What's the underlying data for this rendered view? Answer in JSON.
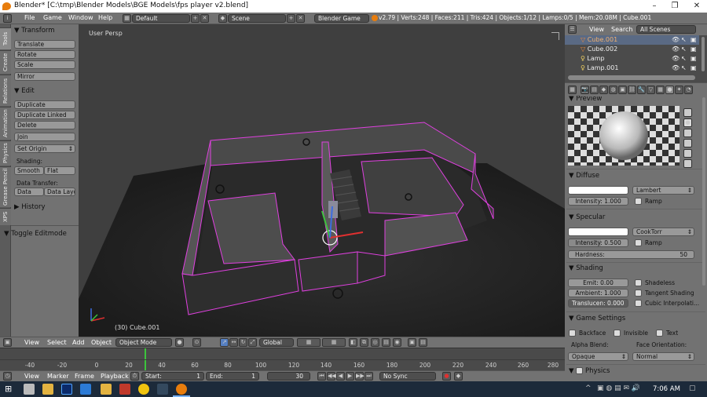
{
  "window": {
    "title": "Blender* [C:\\tmp\\Blender Models\\BGE Models\\fps player v2.blend]",
    "minimize": "–",
    "maximize": "❐",
    "close": "✕"
  },
  "infobar": {
    "menus": [
      "File",
      "Game",
      "Window",
      "Help"
    ],
    "layout": "Default",
    "scene": "Scene",
    "engine": "Blender Game",
    "stats": "v2.79 | Verts:248 | Faces:211 | Tris:424 | Objects:1/12 | Lamps:0/5 | Mem:20.08M | Cube.001"
  },
  "toolshelf": {
    "tabs": [
      "Tools",
      "Create",
      "Relations",
      "Animation",
      "Physics",
      "Grease Pencil",
      "XPS"
    ],
    "transform_header": "Transform",
    "translate": "Translate",
    "rotate": "Rotate",
    "scale": "Scale",
    "mirror": "Mirror",
    "edit_header": "Edit",
    "duplicate": "Duplicate",
    "duplicate_linked": "Duplicate Linked",
    "delete": "Delete",
    "join": "Join",
    "set_origin": "Set Origin",
    "shading_label": "Shading:",
    "smooth": "Smooth",
    "flat": "Flat",
    "data_transfer_label": "Data Transfer:",
    "data": "Data",
    "data_layout": "Data Layo",
    "history_header": "History",
    "toggle_editmode": "Toggle Editmode"
  },
  "viewport": {
    "view_label": "User Persp",
    "object_label": "(30) Cube.001"
  },
  "view3d_header": {
    "view": "View",
    "select": "Select",
    "add": "Add",
    "object": "Object",
    "mode": "Object Mode",
    "orientation": "Global"
  },
  "timeline": {
    "ticks": [
      "-40",
      "-20",
      "0",
      "20",
      "40",
      "60",
      "80",
      "100",
      "120",
      "140",
      "160",
      "180",
      "200",
      "220",
      "240",
      "260",
      "280"
    ],
    "view": "View",
    "marker": "Marker",
    "frame": "Frame",
    "playback": "Playback",
    "start_label": "Start:",
    "start": "1",
    "end_label": "End:",
    "end": "1",
    "current": "30",
    "sync": "No Sync"
  },
  "outliner": {
    "view": "View",
    "search": "Search",
    "filter": "All Scenes",
    "items": [
      "Cube.001",
      "Cube.002",
      "Lamp",
      "Lamp.001"
    ]
  },
  "properties": {
    "preview_header": "Preview",
    "diffuse_header": "Diffuse",
    "diffuse_shader": "Lambert",
    "diffuse_intensity": "Intensity:",
    "diffuse_intensity_value": "1.000",
    "ramp": "Ramp",
    "specular_header": "Specular",
    "specular_shader": "CookTorr",
    "specular_intensity": "Intensity:",
    "specular_intensity_value": "0.500",
    "hardness": "Hardness:",
    "hardness_value": "50",
    "shading_header": "Shading",
    "emit": "Emit:",
    "emit_value": "0.00",
    "ambient": "Ambient:",
    "ambient_value": "1.000",
    "translucency": "Translucen: 0.000",
    "shadeless": "Shadeless",
    "tangent_shading": "Tangent Shading",
    "cubic": "Cubic Interpolati...",
    "game_header": "Game Settings",
    "backface": "Backface",
    "invisible": "Invisible",
    "text": "Text",
    "alpha_blend": "Alpha Blend:",
    "face_orientation": "Face Orientation:",
    "opaque": "Opaque",
    "normal": "Normal",
    "physics_header": "Physics"
  },
  "taskbar": {
    "time": "7:06 AM"
  },
  "colors": {
    "selection_outline": "#e040e0",
    "blender_orange": "#e87d0d",
    "timeline_cursor": "#3cc43c"
  }
}
